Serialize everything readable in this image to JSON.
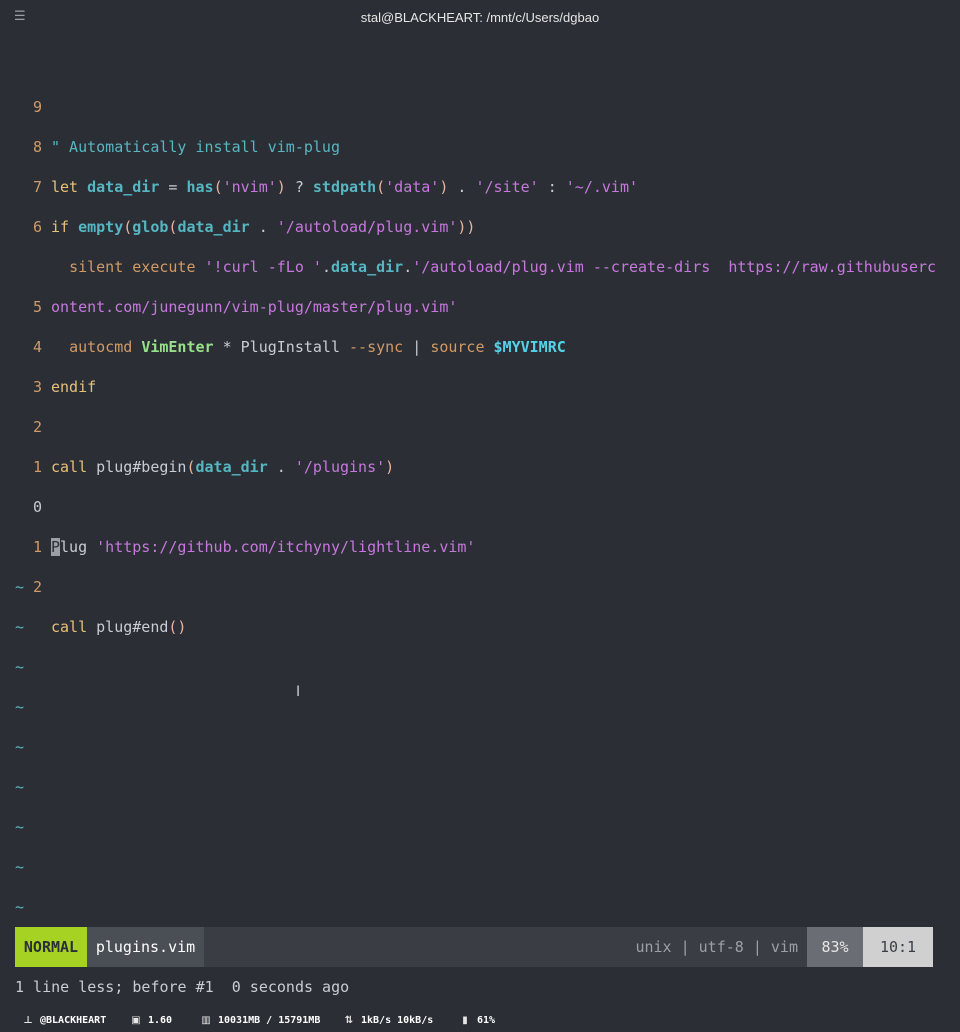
{
  "window": {
    "title": "stal@BLACKHEART: /mnt/c/Users/dgbao",
    "menu_icon": "hamburger-menu-icon"
  },
  "editor": {
    "lines": [
      {
        "num": "9"
      },
      {
        "num": "8"
      },
      {
        "num": "7"
      },
      {
        "num": "6"
      },
      {
        "num": ""
      },
      {
        "num": "5"
      },
      {
        "num": "4"
      },
      {
        "num": "3"
      },
      {
        "num": "2"
      },
      {
        "num": "1"
      },
      {
        "num": "0"
      },
      {
        "num": "1"
      },
      {
        "num": "2"
      }
    ],
    "tildes": [
      "~",
      "~",
      "~",
      "~",
      "~",
      "~",
      "~",
      "~",
      "~"
    ],
    "code": {
      "l9": "\" Automatically install vim-plug",
      "l8_let": "let ",
      "l8_var": "data_dir",
      "l8_eq": " = ",
      "l8_fn": "has",
      "l8_p1": "(",
      "l8_s1": "'nvim'",
      "l8_p2": ")",
      "l8_q": " ? ",
      "l8_fn2": "stdpath",
      "l8_p3": "(",
      "l8_s2": "'data'",
      "l8_p4": ")",
      "l8_dot": " . ",
      "l8_s3": "'/site'",
      "l8_colon": " : ",
      "l8_s4": "'~/.vim'",
      "l7_if": "if ",
      "l7_fn": "empty",
      "l7_p1": "(",
      "l7_fn2": "glob",
      "l7_p2": "(",
      "l7_var": "data_dir",
      "l7_dot": " . ",
      "l7_s": "'/autoload/plug.vim'",
      "l7_p3": "))",
      "l6_indent": "  ",
      "l6_kw": "silent execute ",
      "l6_s1": "'!curl -fLo '",
      "l6_dot": ".",
      "l6_var": "data_dir",
      "l6_dot2": ".",
      "l6_s2": "'/autoload/plug.vim --create-dirs  https://raw.githubuserc",
      "l6_wrap": "ontent.com/junegunn/vim-plug/master/plug.vim'",
      "l5_indent": "  ",
      "l5_kw": "autocmd ",
      "l5_ev": "VimEnter",
      "l5_rest": " * PlugInstall ",
      "l5_sync": "--sync",
      "l5_pipe": " | ",
      "l5_src": "source ",
      "l5_env": "$MYVIMRC",
      "l4": "endif",
      "l2_call": "call ",
      "l2_fn": "plug#begin",
      "l2_p1": "(",
      "l2_var": "data_dir",
      "l2_dot": " . ",
      "l2_s": "'/plugins'",
      "l2_p2": ")",
      "l0_cursor": "P",
      "l0_rest": "lug ",
      "l0_s": "'https://github.com/itchyny/lightline.vim'",
      "l2b_call": "call ",
      "l2b_fn": "plug#end",
      "l2b_p": "()"
    }
  },
  "statusline": {
    "mode": "NORMAL",
    "filename": "plugins.vim",
    "fileinfo": "unix | utf-8 | vim",
    "percent": "83%",
    "position": "10:1"
  },
  "cmdline": {
    "message": "1 line less; before #1  0 seconds ago"
  },
  "taskbar": {
    "host": "@BLACKHEART",
    "host_icon": "network-icon",
    "cpu": "1.60",
    "cpu_icon": "cpu-icon",
    "memory": "10031MB / 15791MB",
    "memory_icon": "memory-icon",
    "network": "1kB/s 10kB/s",
    "network_icon": "updown-arrows-icon",
    "battery": "61%",
    "battery_icon": "battery-icon"
  }
}
